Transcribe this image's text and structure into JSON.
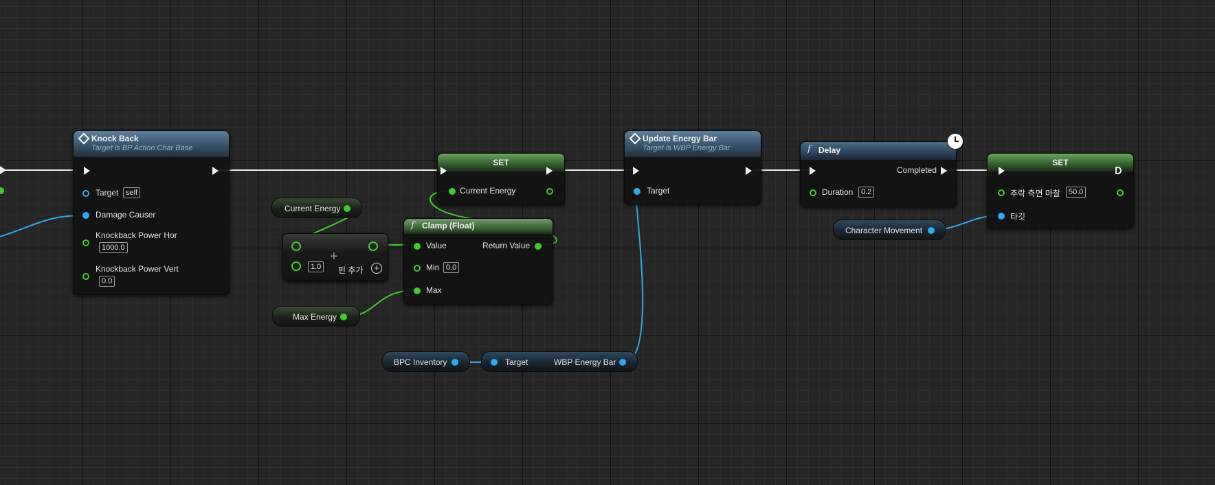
{
  "graph": {
    "knockback": {
      "title": "Knock Back",
      "subtitle": "Target is BP Action Char Base",
      "target_label": "Target",
      "target_value": "self",
      "damage_causer_label": "Damage Causer",
      "hor_label": "Knockback Power Hor",
      "hor_value": "1000.0",
      "vert_label": "Knockback Power Vert",
      "vert_value": "0.0"
    },
    "set1": {
      "title": "SET",
      "pin_label": "Current Energy"
    },
    "current_energy_getter": {
      "label": "Current Energy"
    },
    "add_node": {
      "symbol": "+",
      "value": "1.0",
      "add_pin_label": "핀 추가"
    },
    "clamp": {
      "title": "Clamp (Float)",
      "value_label": "Value",
      "return_label": "Return Value",
      "min_label": "Min",
      "min_value": "0.0",
      "max_label": "Max"
    },
    "max_energy_getter": {
      "label": "Max Energy"
    },
    "update_energy": {
      "title": "Update Energy Bar",
      "subtitle": "Target is WBP Energy Bar",
      "target_label": "Target"
    },
    "bpc_inventory": {
      "label": "BPC Inventory"
    },
    "wbp_getter": {
      "target_label": "Target",
      "output_label": "WBP Energy Bar"
    },
    "delay": {
      "title": "Delay",
      "completed_label": "Completed",
      "duration_label": "Duration",
      "duration_value": "0.2"
    },
    "set2": {
      "title": "SET",
      "pin_label": "추락 측면 마찰",
      "pin_value": "50.0",
      "target_label": "타깃"
    },
    "char_movement": {
      "label": "Character Movement"
    }
  },
  "colors": {
    "exec": "#f0f0f0",
    "float_pin": "#3ecb2b",
    "object_pin": "#2ea8ee",
    "background": "#262626"
  },
  "icons": [
    "event-diamond-icon",
    "function-icon",
    "clock-icon",
    "add-pin-icon",
    "exec-pin-icon"
  ]
}
